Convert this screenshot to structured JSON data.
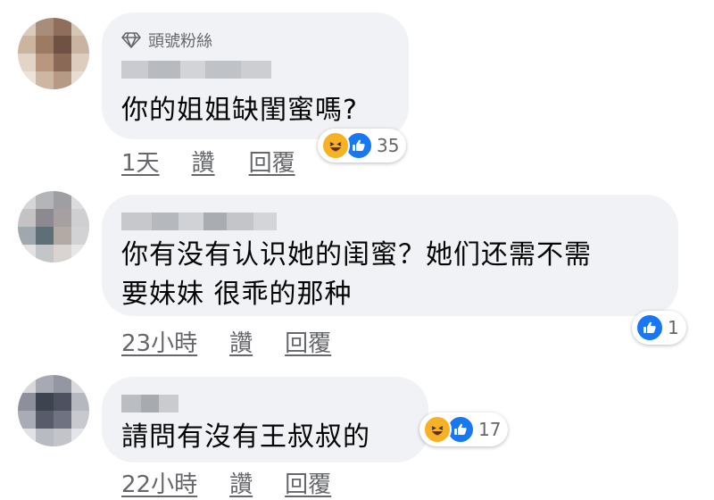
{
  "colors": {
    "bubble": "#f0f2f5",
    "meta": "#65676b",
    "like_blue": "#1877f2",
    "haha_yellow": "#f7b125"
  },
  "comments": [
    {
      "badge_icon": "diamond-icon",
      "badge": "頭號粉絲",
      "text_lines": [
        "你的姐姐缺閨蜜嗎?"
      ],
      "time": "1天",
      "like_label": "讚",
      "reply_label": "回覆",
      "reactions": {
        "icons": [
          "haha-icon",
          "like-icon"
        ],
        "count": "35"
      }
    },
    {
      "text_lines": [
        "你有没有认识她的闺蜜？她们还需不需",
        "要妹妹 很乖的那种"
      ],
      "time": "23小時",
      "like_label": "讚",
      "reply_label": "回覆",
      "reactions": {
        "icons": [
          "like-icon"
        ],
        "count": "1"
      }
    },
    {
      "text_lines": [
        "請問有沒有王叔叔的"
      ],
      "time": "22小時",
      "like_label": "讚",
      "reply_label": "回覆",
      "reactions": {
        "icons": [
          "haha-icon",
          "like-icon"
        ],
        "count": "17"
      }
    }
  ]
}
